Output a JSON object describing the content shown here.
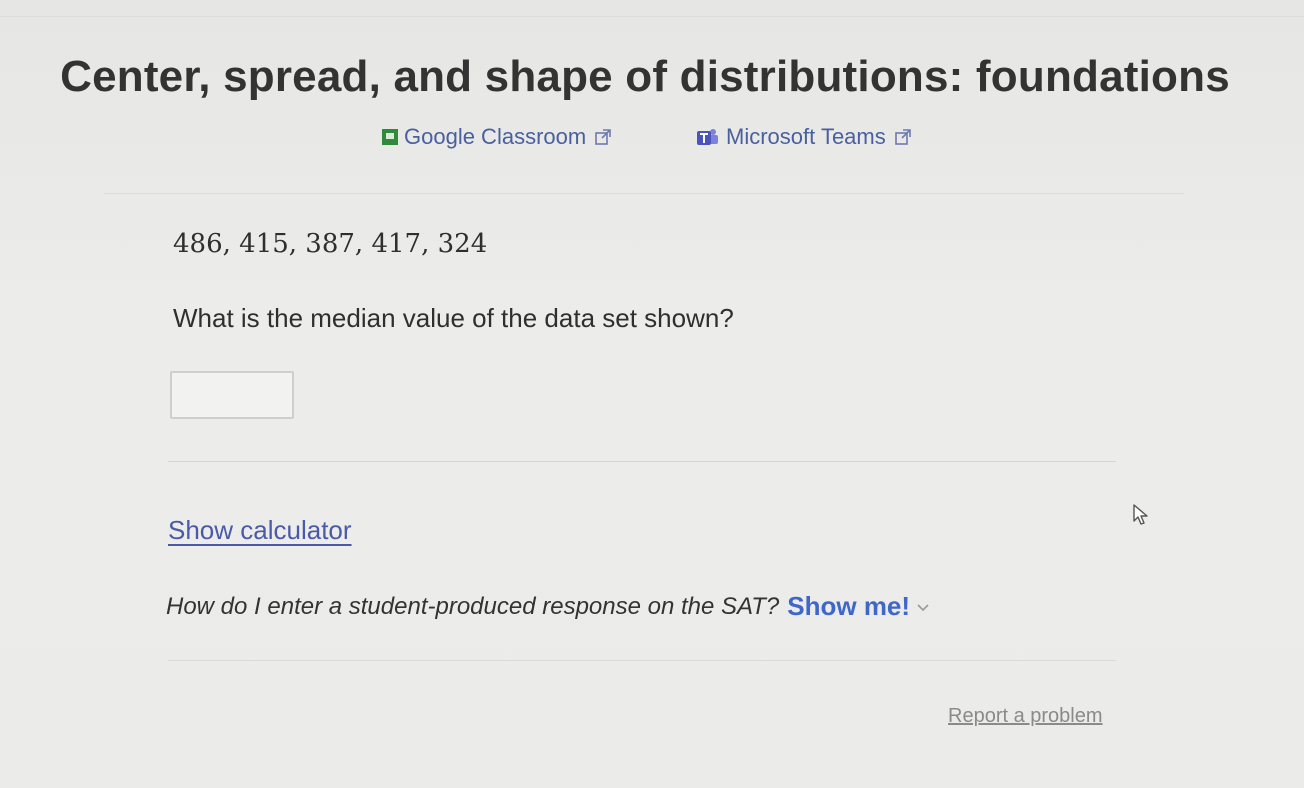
{
  "header": {
    "title": "Center, spread, and shape of distributions: foundations"
  },
  "share": {
    "google_classroom_label": "Google Classroom",
    "microsoft_teams_label": "Microsoft Teams"
  },
  "problem": {
    "dataset": "486, 415, 387, 417, 324",
    "question": "What is the median value of the data set shown?",
    "answer_value": ""
  },
  "tools": {
    "calculator_link": "Show calculator"
  },
  "help": {
    "prompt": "How do I enter a student-produced response on the SAT?",
    "show_me": "Show me!"
  },
  "footer": {
    "report_problem": "Report a problem"
  },
  "colors": {
    "link": "#4b5aa6",
    "show_me": "#3f67c9",
    "google_green": "#2f8a3c",
    "teams_purple": "#5b5fc7"
  }
}
